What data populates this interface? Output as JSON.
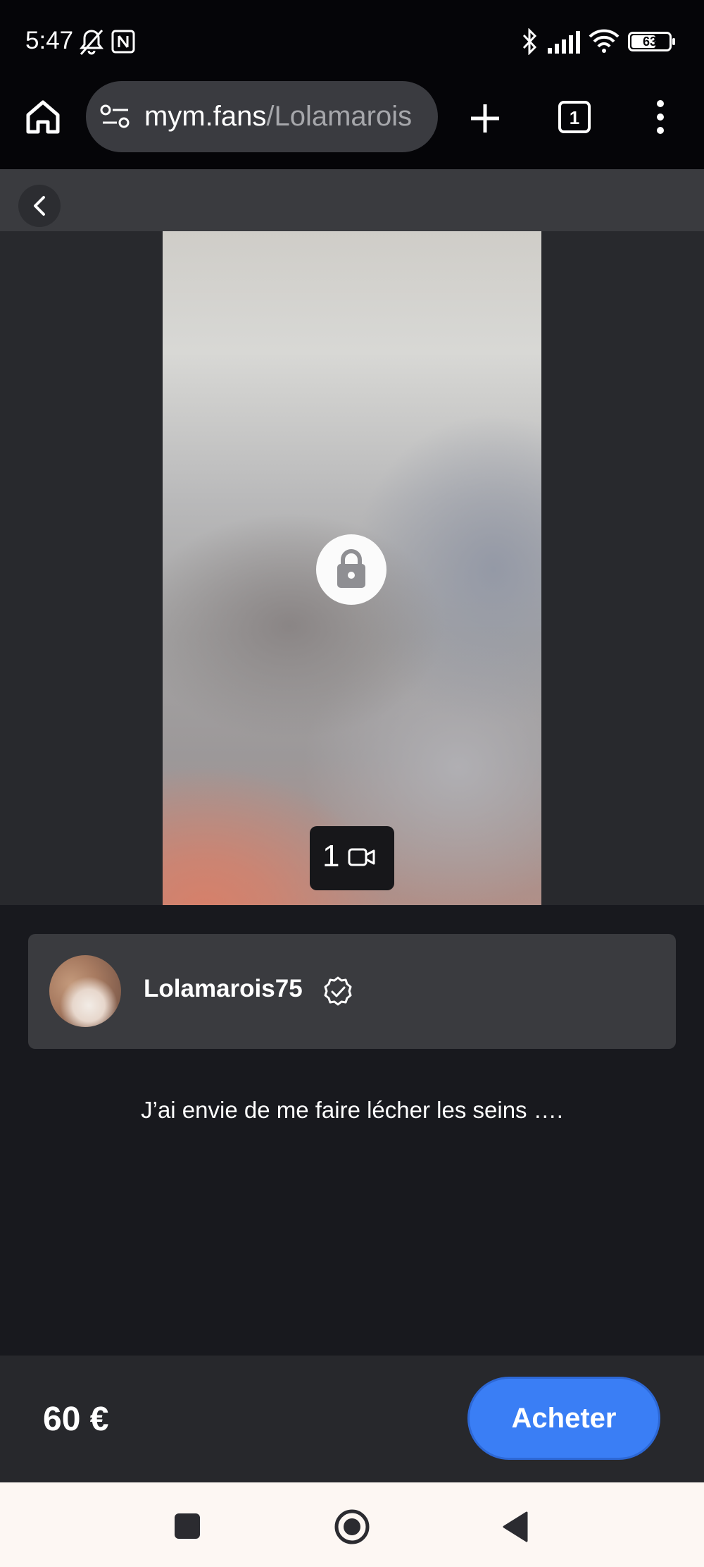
{
  "status_bar": {
    "time": "5:47",
    "battery": "63",
    "icons": [
      "bell-off-icon",
      "nfc-icon",
      "bluetooth-icon",
      "signal-icon",
      "wifi-icon",
      "battery-icon"
    ]
  },
  "browser": {
    "url_domain": "mym.fans",
    "url_path": "/Lolamarois",
    "tab_count": "1",
    "icons": [
      "home-icon",
      "site-settings-icon",
      "new-tab-icon",
      "tabs-icon",
      "more-menu-icon"
    ]
  },
  "page": {
    "media": {
      "count": "1",
      "icons": [
        "lock-icon",
        "video-icon"
      ]
    },
    "creator": {
      "name": "Lolamarois75",
      "icons": [
        "verified-badge-icon"
      ]
    },
    "caption": "J’ai envie de me faire lécher les seins ….",
    "purchase": {
      "price": "60 €",
      "buy_label": "Acheter"
    }
  },
  "system_nav": {
    "icons": [
      "recents-icon",
      "home-circle-icon",
      "back-triangle-icon"
    ]
  },
  "colors": {
    "accent": "#3a7ef5",
    "page_bg": "#18191e",
    "card_bg": "#3a3b3f",
    "status_bg": "#050508"
  }
}
